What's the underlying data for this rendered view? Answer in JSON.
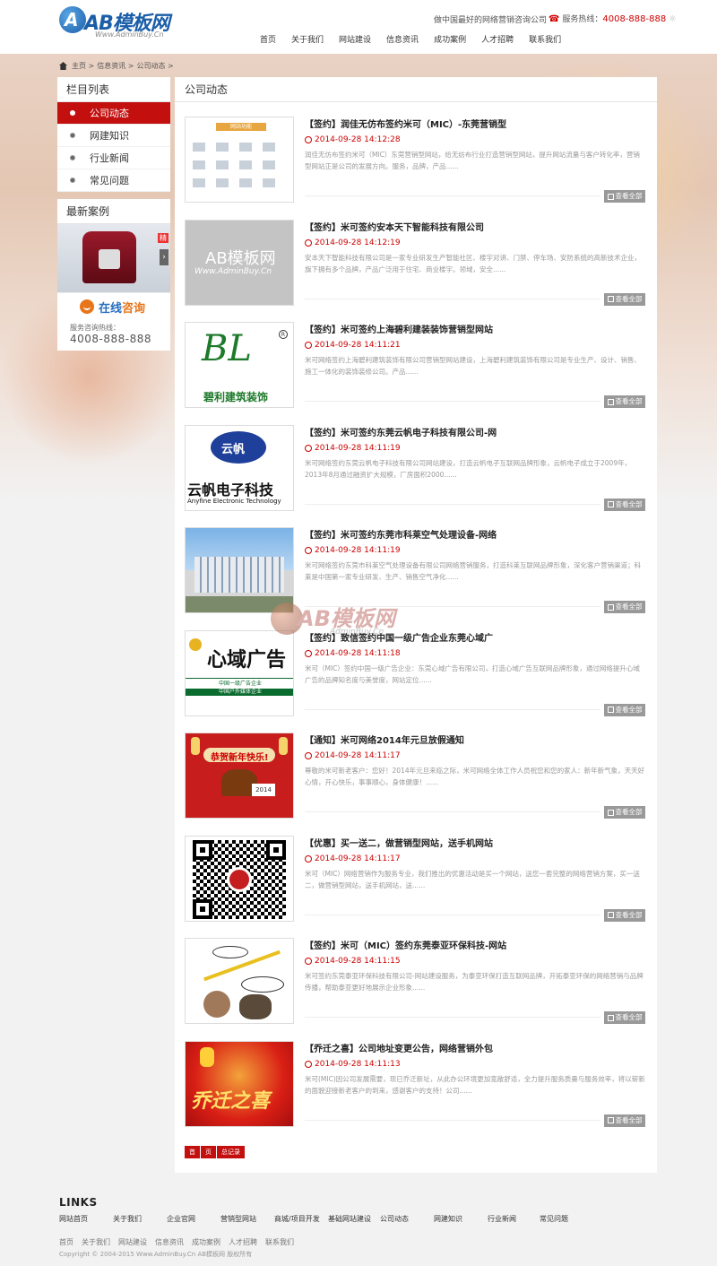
{
  "header": {
    "logo_text": "AB模板网",
    "logo_url": "Www.AdminBuy.Cn",
    "tagline": "做中国最好的网络营销咨询公司",
    "hotline_label": "服务热线：",
    "hotline_number": "4008-888-888",
    "nav": [
      "首页",
      "关于我们",
      "网站建设",
      "信息资讯",
      "成功案例",
      "人才招聘",
      "联系我们"
    ]
  },
  "breadcrumb": [
    "主页",
    "信息资讯",
    "公司动态"
  ],
  "sidebar": {
    "category_title": "栏目列表",
    "categories": [
      "公司动态",
      "网建知识",
      "行业新闻",
      "常见问题"
    ],
    "case_title": "最新案例",
    "consult_prefix": "在线",
    "consult_word": "咨询",
    "hotline_label": "服务咨询热线：",
    "hotline_number": "4008-888-888"
  },
  "main": {
    "title": "公司动态",
    "more_label": "查看全部",
    "items": [
      {
        "title": "【签约】润佳无仿布签约米可（MIC）-东莞营销型",
        "date": "2014-09-28 14:12:28",
        "summary": "润佳无仿布签约米可（MIC）东莞营销型网站，给无纺布行业打造营销型网站，提升网站流量与客户转化率，营销型网站正是公司的发展方向。服务，品牌，产品......"
      },
      {
        "title": "【签约】米可签约安本天下智能科技有限公司",
        "date": "2014-09-28 14:12:19",
        "summary": "安本天下智能科技有限公司是一家专业研发生产智能社区、楼宇对讲、门禁、停车场、安防系统的高新技术企业，旗下拥有多个品牌，产品广泛用于住宅、商业楼宇。领域，安全...... "
      },
      {
        "title": "【签约】米可签约上海碧利建装装饰营销型网站",
        "date": "2014-09-28 14:11:21",
        "summary": "米可网络签约上海碧利建筑装饰有限公司营销型网站建设，上海碧利建筑装饰有限公司是专业生产、设计、销售、施工一体化的装饰装修公司。产品......"
      },
      {
        "title": "【签约】米可签约东莞云帆电子科技有限公司-网",
        "date": "2014-09-28 14:11:19",
        "summary": "米可网络签约东莞云帆电子科技有限公司网站建设，打造云帆电子互联网品牌形象，云帆电子成立于2009年，2013年8月通过融资扩大规模，厂房面积2000......"
      },
      {
        "title": "【签约】米可签约东莞市科莱空气处理设备-网络",
        "date": "2014-09-28 14:11:19",
        "summary": "米可网络签约东莞市科莱空气处理设备有限公司网络营销服务，打造科莱互联网品牌形象，深化客户营销渠道；科莱是中国第一家专业研发、生产、销售空气净化......"
      },
      {
        "title": "【签约】致信签约中国一级广告企业东莞心域广",
        "date": "2014-09-28 14:11:18",
        "summary": "米可（MIC）签约中国一级广告企业：东莞心域广告有限公司，打造心域广告互联网品牌形象，通过网络提升心域广告的品牌知名度与美誉度，网站定位......"
      },
      {
        "title": "【通知】米可网络2014年元旦放假通知",
        "date": "2014-09-28 14:11:17",
        "summary": "尊敬的米可新老客户：您好！2014年元旦来临之际，米可网络全体工作人员祝您和您的家人：新年新气象，天天好心情，开心快乐，事事顺心，身体健康！......"
      },
      {
        "title": "【优惠】买一送二，做营销型网站，送手机网站",
        "date": "2014-09-28 14:11:17",
        "summary": "米可（MIC）网络营销作为服务专业，我们推出的优惠活动是买一个网站，送您一套完整的网络营销方案，买一送二，做营销型网站，送手机网站，送......"
      },
      {
        "title": "【签约】米可（MIC）签约东莞泰亚环保科技-网站",
        "date": "2014-09-28 14:11:15",
        "summary": "米可签约东莞泰亚环保科技有限公司-网站建设服务，为泰亚环保打造互联网品牌，开拓泰亚环保的网络营销与品牌传播，帮助泰亚更好地展示企业形象......"
      },
      {
        "title": "【乔迁之喜】公司地址变更公告，网络营销外包",
        "date": "2014-09-28 14:11:13",
        "summary": "米可(MIC)因公司发展需要，现已乔迁新址，从此办公环境更加宽敞舒适，全力提升服务质量与服务效率，将以崭新的面貌迎接新老客户的到来，感谢客户的支持！公司......"
      }
    ],
    "pager": [
      "首",
      "页",
      "总记录"
    ]
  },
  "thumbs": {
    "t1_bar": "网站功能",
    "t2_logo": "AB模板网",
    "t2_url": "Www.AdminBuy.Cn",
    "t3_mark": "BL",
    "t3_name": "碧利建筑装饰",
    "t4_mark": "云帆",
    "t4_name": "云帆电子科技",
    "t4_en": "Anyfine Electronic Technology",
    "t6_name": "心域广告",
    "t6_line1": "中国一级广告企业",
    "t6_line2": "中国户外媒体企业",
    "t7_banner": "恭贺新年快乐!",
    "t7_sign": "2014",
    "t10_text": "乔迁之喜"
  },
  "watermark": {
    "name": "AB模板网",
    "url": "AdminBuy.Cn"
  },
  "footer": {
    "links_title": "LINKS",
    "links": [
      "网站首页",
      "关于我们",
      "企业官网",
      "营销型网站",
      "商城/项目开发",
      "基础网站建设",
      "公司动态",
      "网建知识",
      "行业新闻",
      "常见问题"
    ],
    "nav": [
      "首页",
      "关于我们",
      "网站建设",
      "信息资讯",
      "成功案例",
      "人才招聘",
      "联系我们"
    ],
    "copyright": "Copyright © 2004-2015 Www.AdminBuy.Cn AB模板网 版权所有"
  }
}
